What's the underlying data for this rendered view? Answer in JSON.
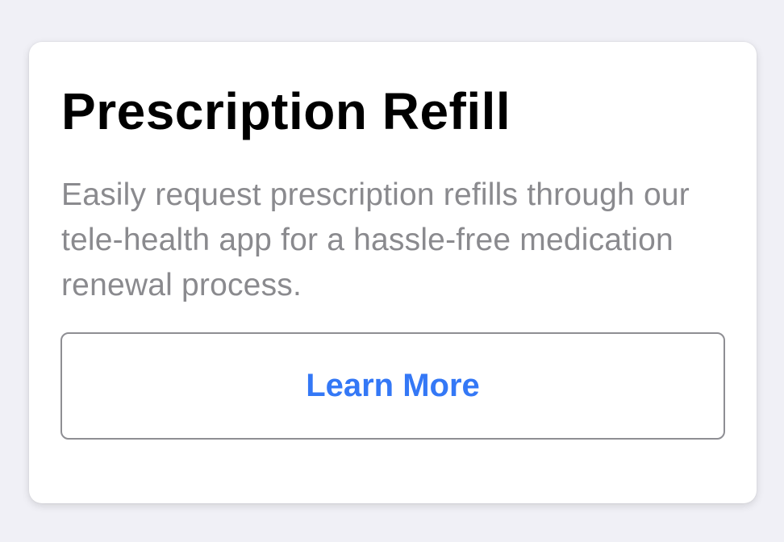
{
  "card": {
    "title": "Prescription Refill",
    "description": "Easily request prescription refills through our tele-health app for a hassle-free medication renewal process.",
    "button_label": "Learn More"
  },
  "colors": {
    "background": "#f0f0f6",
    "card": "#ffffff",
    "title": "#000000",
    "description": "#8a8a8e",
    "button_text": "#3478f6",
    "button_border": "#8e8e93"
  }
}
